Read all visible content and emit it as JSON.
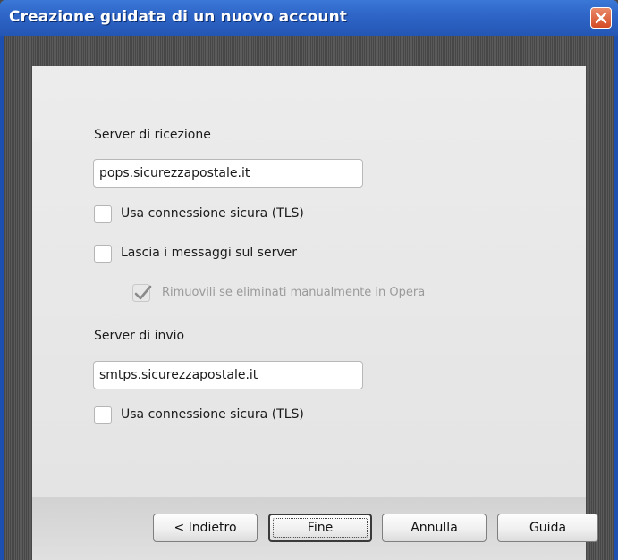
{
  "window": {
    "title": "Creazione guidata di un nuovo account"
  },
  "form": {
    "incoming_label": "Server di ricezione",
    "incoming_server": "pops.sicurezzapostale.it",
    "incoming_tls_label": "Usa connessione sicura (TLS)",
    "incoming_tls_checked": false,
    "leave_on_server_label": "Lascia i messaggi sul server",
    "leave_on_server_checked": false,
    "remove_if_deleted_label": "Rimuovili se eliminati manualmente in Opera",
    "remove_if_deleted_checked": true,
    "remove_if_deleted_disabled": true,
    "outgoing_label": "Server di invio",
    "outgoing_server": "smtps.sicurezzapostale.it",
    "outgoing_tls_label": "Usa connessione sicura (TLS)",
    "outgoing_tls_checked": false
  },
  "buttons": {
    "back": "< Indietro",
    "finish": "Fine",
    "cancel": "Annulla",
    "help": "Guida"
  },
  "colors": {
    "titlebar": "#2f66c8",
    "close_button": "#d44a24",
    "frame": "#4a4a4a"
  }
}
